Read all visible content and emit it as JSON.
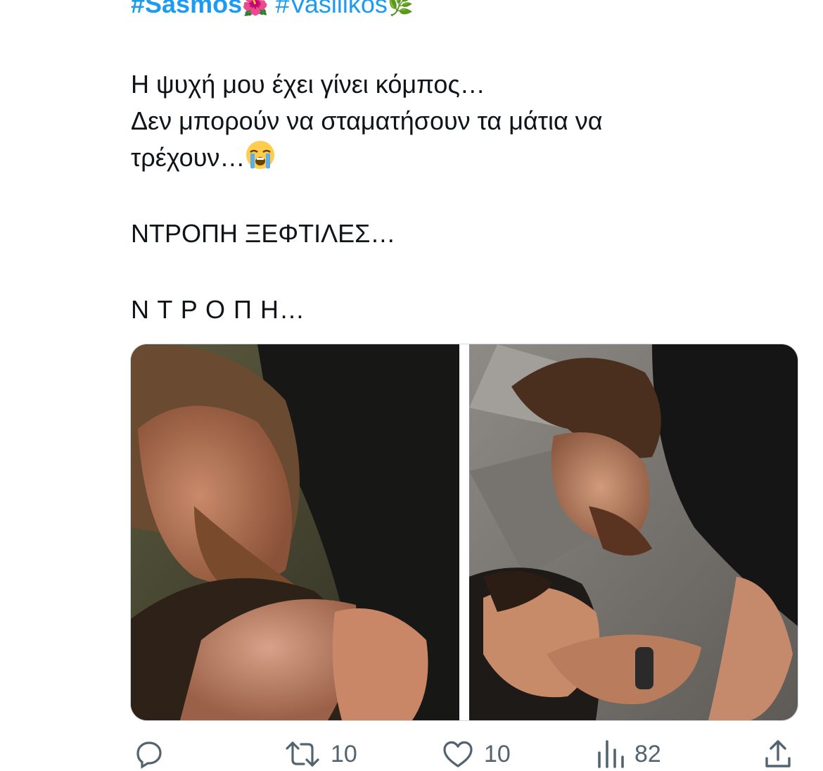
{
  "tweet": {
    "hashtag_1": "#Sasmos",
    "hashtag_1_emoji": "🌺",
    "hashtag_2": "#Vasilikos",
    "hashtag_2_emoji": "🌿",
    "line_1": "Η ψυχή μου έχει γίνει κόμπος…",
    "line_2": "Δεν μπορούν να σταματήσουν τα μάτια να",
    "line_3": "τρέχουν…",
    "line_3_emoji": "loudly-crying-face-icon",
    "line_4": "ΝΤΡΟΠΗ ΞΕΦΤΙΛΕΣ…",
    "line_5": "Ν Τ Ρ Ο Π Η…"
  },
  "media": {
    "images": [
      {
        "name": "photo-left",
        "description_icon": "photo"
      },
      {
        "name": "photo-right",
        "description_icon": "photo"
      }
    ]
  },
  "actions": {
    "reply": {
      "icon": "reply-icon",
      "count": ""
    },
    "repost": {
      "icon": "repost-icon",
      "count": "10"
    },
    "like": {
      "icon": "heart-icon",
      "count": "10"
    },
    "views": {
      "icon": "views-icon",
      "count": "82"
    },
    "share": {
      "icon": "share-icon",
      "count": ""
    }
  },
  "colors": {
    "hashtag": "#1d9bf0",
    "text": "#0f1419",
    "action": "#536471"
  }
}
